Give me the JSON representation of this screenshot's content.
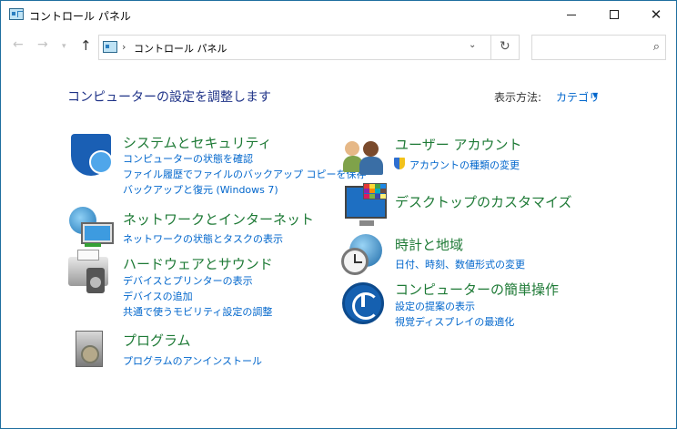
{
  "window": {
    "title": "コントロール パネル"
  },
  "address": {
    "path": "コントロール パネル",
    "separator": "›",
    "search_placeholder": ""
  },
  "main": {
    "heading": "コンピューターの設定を調整します",
    "view_by_label": "表示方法:",
    "view_by_value": "カテゴリ"
  },
  "left": [
    {
      "title": "システムとセキュリティ",
      "links": [
        "コンピューターの状態を確認",
        "ファイル履歴でファイルのバックアップ コピーを保存",
        "バックアップと復元 (Windows 7)"
      ]
    },
    {
      "title": "ネットワークとインターネット",
      "links": [
        "ネットワークの状態とタスクの表示"
      ]
    },
    {
      "title": "ハードウェアとサウンド",
      "links": [
        "デバイスとプリンターの表示",
        "デバイスの追加",
        "共通で使うモビリティ設定の調整"
      ]
    },
    {
      "title": "プログラム",
      "links": [
        "プログラムのアンインストール"
      ]
    }
  ],
  "right": [
    {
      "title": "ユーザー アカウント",
      "links": [
        "アカウントの種類の変更"
      ]
    },
    {
      "title": "デスクトップのカスタマイズ",
      "links": []
    },
    {
      "title": "時計と地域",
      "links": [
        "日付、時刻、数値形式の変更"
      ]
    },
    {
      "title": "コンピューターの簡単操作",
      "links": [
        "設定の提案の表示",
        "視覚ディスプレイの最適化"
      ]
    }
  ],
  "icons": {
    "system": "shield-icon",
    "network": "network-globe-icon",
    "hardware": "printer-speaker-icon",
    "programs": "program-disc-icon",
    "users": "users-icon",
    "uac": "uac-shield-icon",
    "desktop": "monitor-palette-icon",
    "clock": "clock-globe-icon",
    "access": "ease-of-access-icon"
  },
  "colors": {
    "category_title": "#1e7a36",
    "link": "#0066cc",
    "heading": "#1e3287"
  }
}
